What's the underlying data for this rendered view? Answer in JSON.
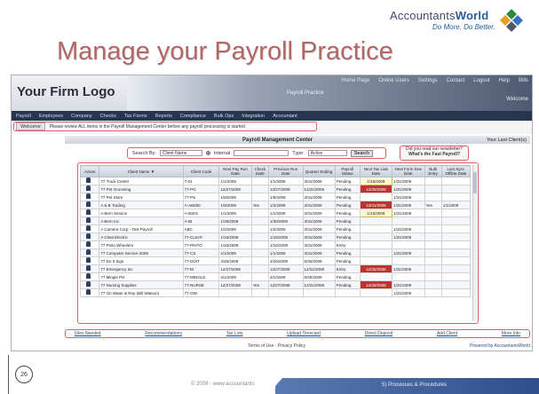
{
  "brand": {
    "name_part1": "Accountants",
    "name_part2": "World",
    "tagline": "Do More. Do Better.",
    "colors": [
      "#2e8a3e",
      "#3a6fc0",
      "#e0a020",
      "#505a6a"
    ]
  },
  "slide": {
    "title": "Manage your Payroll Practice",
    "page_number": "26",
    "copyright": "© 2009 - www.accountants",
    "section": "5) Processes & Procedures"
  },
  "app": {
    "firm_logo": "Your Firm Logo",
    "header_links": [
      "Home Page",
      "Online Users",
      "Settings",
      "Contact",
      "Logout",
      "Help",
      "Bills"
    ],
    "header_title": "Payroll Practice",
    "welcome": "Welcome",
    "menu": [
      "Payroll",
      "Employees",
      "Company",
      "Checks",
      "Tax Forms",
      "Reports",
      "Compliance",
      "Bulk Ops",
      "Integration",
      "Accountant"
    ],
    "welcome_button": "Welcome",
    "info_text": "Please review ALL items in the Payroll Management Center before any payroll processing is started",
    "center_title": "Payroll Management Center",
    "center_right": "Your Last Client(s)",
    "search": {
      "label": "Search By:",
      "field_value": "Client Name",
      "radio_label": "Internal",
      "type_label": "Type:",
      "type_value": "Active",
      "button": "Search"
    },
    "promo": {
      "line1": "Did you read our newsletter?",
      "line2": "What's the Fast Payroll?"
    },
    "columns": [
      "Action",
      "Client Name ▼",
      "Client Code",
      "Next Pay Run Date",
      "Check Date",
      "Previous Run Date",
      "Quarter Ending",
      "Payroll Status",
      "Next Tax Liab Date",
      "Next Form Due Date",
      "Bulk Entry",
      "Last Sync Offline Date"
    ],
    "rows": [
      [
        "",
        "77 Truck Center",
        "T-01",
        "1/1/2009",
        "",
        "1/1/2009",
        "3/31/2009",
        "Pending",
        "1/15/2009",
        "1/31/2009",
        "",
        ""
      ],
      [
        "",
        "77 Pet Grooming",
        "77-PG",
        "12/27/2008",
        "",
        "12/27/2008",
        "12/31/2008",
        "Pending",
        "12/30/2008",
        "1/31/2009",
        "",
        ""
      ],
      [
        "",
        "77 Pet Store",
        "77-PS",
        "1/8/2009",
        "",
        "1/8/2009",
        "3/31/2009",
        "Pending",
        "",
        "1/31/2009",
        "",
        ""
      ],
      [
        "",
        "A & B Trading",
        "A-AB000",
        "1/9/2009",
        "Yes",
        "1/2/2009",
        "3/31/2009",
        "Pending",
        "12/31/2008",
        "1/31/2009",
        "Yes",
        "1/1/2009"
      ],
      [
        "",
        "A Bern Service",
        "A-BS01",
        "1/1/2009",
        "",
        "1/1/2009",
        "3/31/2009",
        "Pending",
        "1/15/2009",
        "1/31/2009",
        "",
        ""
      ],
      [
        "",
        "A Bern Inc",
        "A-BI",
        "1/30/2009",
        "",
        "1/30/2009",
        "3/31/2009",
        "Pending",
        "",
        "",
        "",
        ""
      ],
      [
        "",
        "A Camera Corp - Test Payroll",
        "ABC",
        "1/2/2009",
        "",
        "1/2/2009",
        "3/31/2009",
        "Pending",
        "",
        "1/31/2009",
        "",
        ""
      ],
      [
        "",
        "A Cleat Electric",
        "77-CLEAT",
        "1/16/2009",
        "",
        "1/16/2009",
        "3/31/2009",
        "Pending",
        "",
        "1/31/2009",
        "",
        ""
      ],
      [
        "",
        "77 Pinto Wheelers",
        "77-PINTO",
        "1/16/2009",
        "",
        "1/16/2009",
        "3/31/2009",
        "Entry",
        "",
        "",
        "",
        ""
      ],
      [
        "",
        "77 Computer Service 2009",
        "77-CS",
        "1/1/2009",
        "",
        "1/1/2009",
        "3/31/2009",
        "Pending",
        "",
        "1/31/2009",
        "",
        ""
      ],
      [
        "",
        "77 Do It Sign",
        "77-DOIT",
        "4/26/2009",
        "",
        "4/26/2009",
        "6/30/2009",
        "Pending",
        "",
        "",
        "",
        ""
      ],
      [
        "",
        "77 Emergency Inc",
        "77-EI",
        "12/27/2008",
        "",
        "12/27/2008",
        "12/31/2008",
        "Entry",
        "12/30/2008",
        "1/31/2009",
        "",
        ""
      ],
      [
        "",
        "77 Mingle Pie",
        "77-MINGLE",
        "4/1/2009",
        "",
        "4/1/2009",
        "6/30/2009",
        "Pending",
        "",
        "",
        "",
        ""
      ],
      [
        "",
        "77 Nursing Supplies",
        "77-NURSE",
        "12/27/2008",
        "Yes",
        "12/27/2008",
        "12/31/2008",
        "Pending",
        "12/30/2008",
        "1/31/2009",
        "",
        ""
      ],
      [
        "",
        "77 On Water & Rep (Bill Watson)",
        "77-OW",
        "",
        "",
        "",
        "",
        "",
        "",
        "1/31/2009",
        "",
        ""
      ]
    ],
    "flagged_cells": {
      "bad": [
        [
          1,
          8
        ],
        [
          3,
          8
        ],
        [
          11,
          8
        ],
        [
          13,
          8
        ]
      ],
      "ok": [
        [
          0,
          8
        ],
        [
          4,
          8
        ]
      ]
    },
    "footer_links": [
      "Files Needed",
      "Recommendations",
      "Tax Lots",
      "Upload Timecard",
      "Direct Deposit",
      "Add Client",
      "More Info"
    ],
    "terms": "Terms of Use · Privacy Policy",
    "powered_by": "Powered by AccountantsWorld"
  }
}
